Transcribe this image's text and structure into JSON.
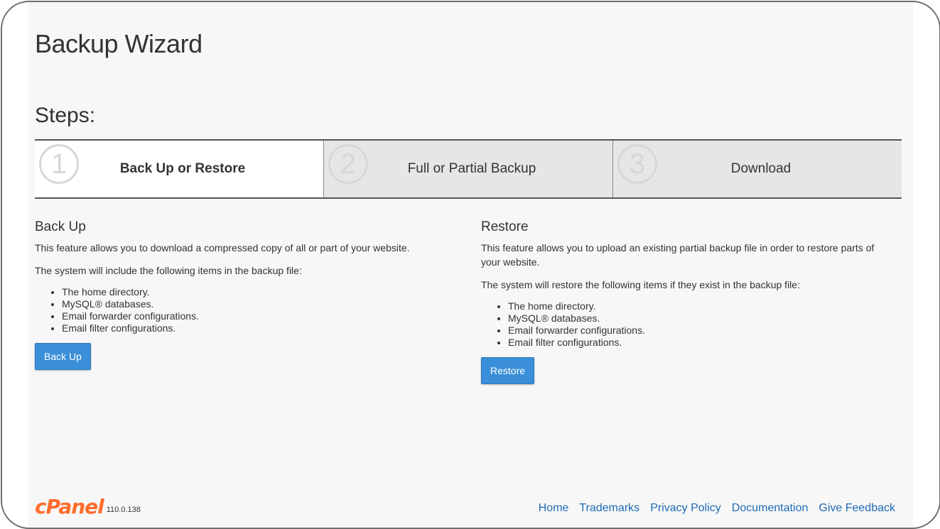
{
  "page": {
    "title": "Backup Wizard",
    "steps_heading": "Steps:"
  },
  "steps": [
    {
      "number": "1",
      "label": "Back Up or Restore",
      "active": true
    },
    {
      "number": "2",
      "label": "Full or Partial Backup",
      "active": false
    },
    {
      "number": "3",
      "label": "Download",
      "active": false
    }
  ],
  "backup": {
    "heading": "Back Up",
    "description": "This feature allows you to download a compressed copy of all or part of your website.",
    "list_intro": "The system will include the following items in the backup file:",
    "items": [
      "The home directory.",
      "MySQL® databases.",
      "Email forwarder configurations.",
      "Email filter configurations."
    ],
    "button_label": "Back Up"
  },
  "restore": {
    "heading": "Restore",
    "description": "This feature allows you to upload an existing partial backup file in order to restore parts of your website.",
    "list_intro": "The system will restore the following items if they exist in the backup file:",
    "items": [
      "The home directory.",
      "MySQL® databases.",
      "Email forwarder configurations.",
      "Email filter configurations."
    ],
    "button_label": "Restore"
  },
  "footer": {
    "logo_text": "cPanel",
    "version": "110.0.138",
    "links": [
      "Home",
      "Trademarks",
      "Privacy Policy",
      "Documentation",
      "Give Feedback"
    ]
  },
  "colors": {
    "accent": "#3a8fd8",
    "link": "#1f6bb5",
    "brand": "#ff6c2c"
  }
}
